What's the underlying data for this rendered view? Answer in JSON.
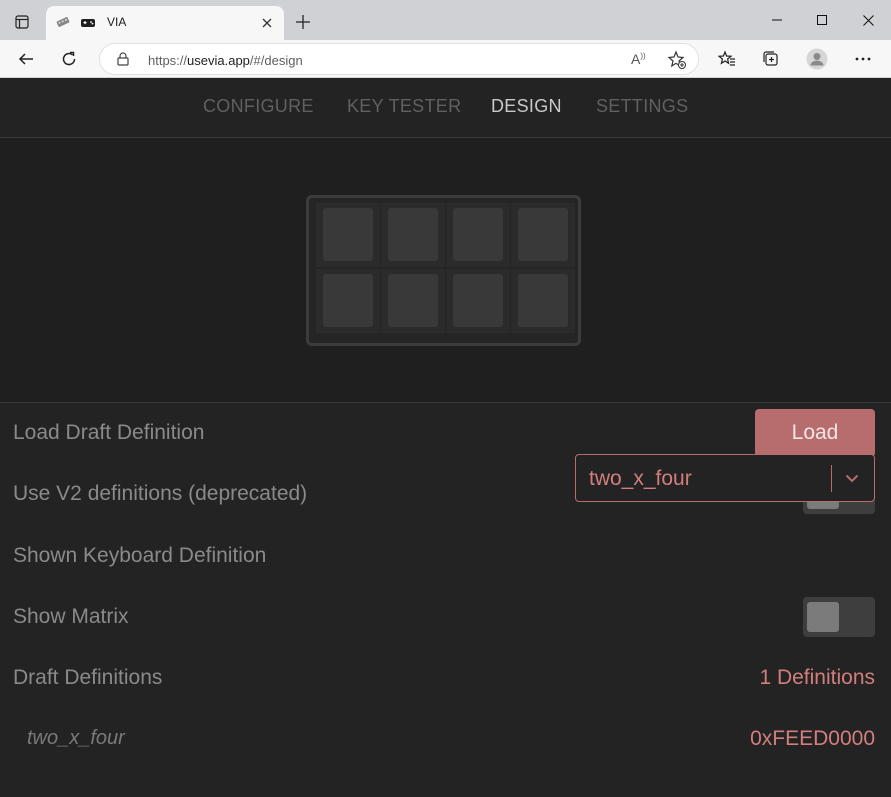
{
  "browser": {
    "tab_title": "VIA",
    "url_prefix": "https://",
    "url_host": "usevia.app",
    "url_path": "/#/design"
  },
  "nav": {
    "items": [
      {
        "label": "CONFIGURE"
      },
      {
        "label": "KEY TESTER"
      },
      {
        "label": "DESIGN"
      },
      {
        "label": "SETTINGS"
      }
    ],
    "active": "DESIGN"
  },
  "keyboard_preview": {
    "rows": 2,
    "cols": 4
  },
  "settings": {
    "load_draft": {
      "label": "Load Draft Definition",
      "button": "Load"
    },
    "use_v2": {
      "label": "Use V2 definitions (deprecated)",
      "enabled": false
    },
    "shown_definition": {
      "label": "Shown Keyboard Definition",
      "value": "two_x_four"
    },
    "show_matrix": {
      "label": "Show Matrix",
      "enabled": false
    },
    "draft_definitions": {
      "label": "Draft Definitions",
      "count_text": "1 Definitions"
    },
    "definition_entry": {
      "name": "two_x_four",
      "id": "0xFEED0000"
    }
  },
  "colors": {
    "accent": "#b76d6d",
    "accent_text": "#d37e7e",
    "background": "#232323"
  }
}
